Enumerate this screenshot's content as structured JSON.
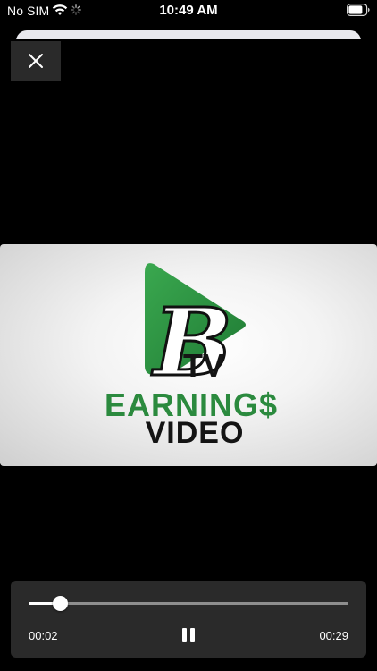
{
  "status_bar": {
    "carrier": "No SIM",
    "time": "10:49 AM"
  },
  "video": {
    "logo_letter": "B",
    "logo_tv": "TV",
    "logo_line1": "EARNING$",
    "logo_line2": "VIDEO",
    "brand_green": "#2b8a3e",
    "brand_dark": "#111111"
  },
  "player": {
    "current_time": "00:02",
    "total_time": "00:29",
    "progress": 0.1,
    "state": "playing"
  },
  "icons": {
    "close": "close-icon",
    "pause": "pause-icon",
    "wifi": "wifi-icon",
    "battery": "battery-icon"
  }
}
